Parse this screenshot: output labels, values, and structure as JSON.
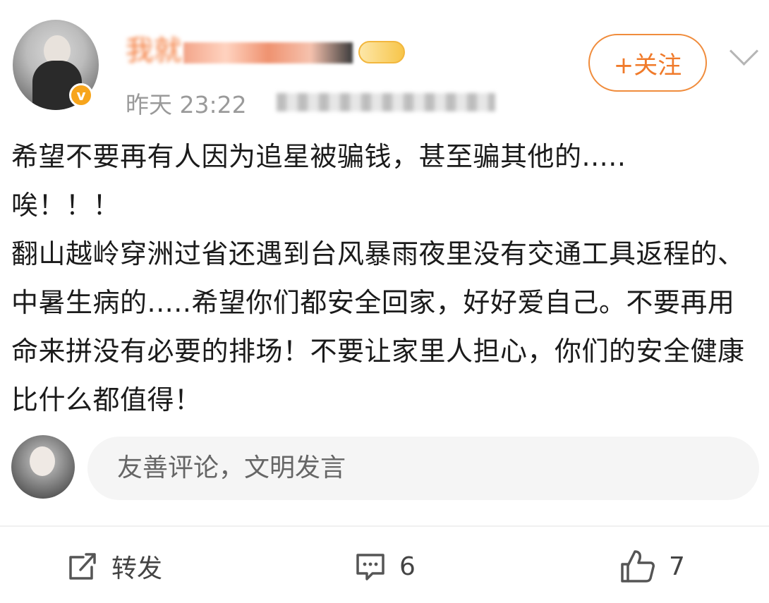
{
  "post": {
    "username_partial": "我就",
    "time": "昨天 23:22",
    "follow_label": "+关注",
    "content": [
      "希望不要再有人因为追星被骗钱，甚至骗其他的.....",
      "唉！！！",
      "翻山越岭穿洲过省还遇到台风暴雨夜里没有交通工具返程的、中暑生病的.....希望你们都安全回家，好好爱自己。不要再用命来拼没有必要的排场！不要让家里人担心，你们的安全健康比什么都值得！"
    ]
  },
  "comment": {
    "placeholder": "友善评论，文明发言"
  },
  "actions": {
    "repost_label": "转发",
    "comment_count": "6",
    "like_count": "7"
  },
  "colors": {
    "accent_orange": "#f07a2a",
    "verify_badge": "#f7a51c",
    "meta_gray": "#9a9a9a"
  },
  "icons": {
    "verify": "verified-badge-icon",
    "more": "chevron-down-icon",
    "repost": "repost-icon",
    "comment": "comment-icon",
    "like": "thumbs-up-icon"
  }
}
